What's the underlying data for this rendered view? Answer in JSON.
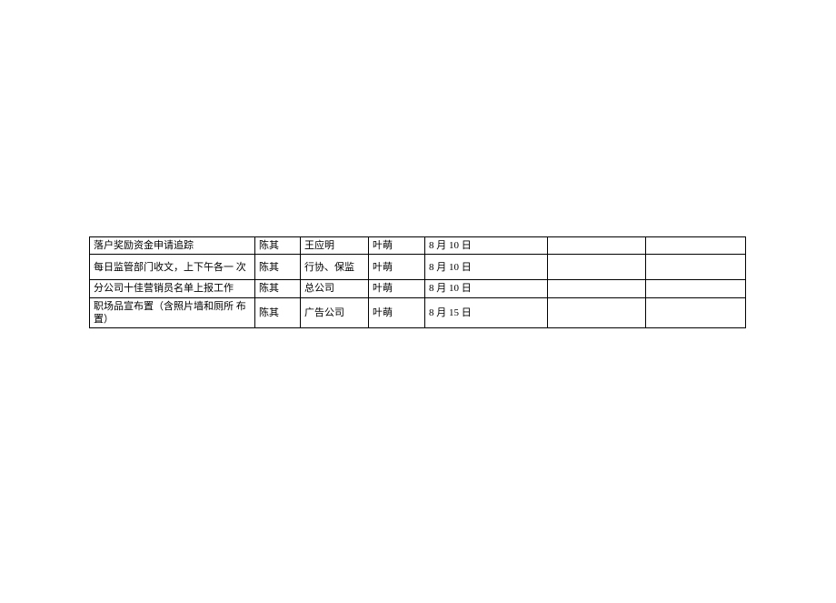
{
  "table": {
    "rows": [
      {
        "task": "落户奖励资金申请追踪",
        "owner": "陈其",
        "dept": "王应明",
        "lead": "叶萌",
        "date": "8 月 10 日",
        "c6": "",
        "c7": ""
      },
      {
        "task": "每日监管部门收文，上下午各一 次",
        "owner": "陈其",
        "dept": "行协、保监",
        "lead": "叶萌",
        "date": "8 月 10 日",
        "c6": "",
        "c7": ""
      },
      {
        "task": "分公司十佳营销员名单上报工作",
        "owner": "陈其",
        "dept": "总公司",
        "lead": "叶萌",
        "date": "8 月 10 日",
        "c6": "",
        "c7": ""
      },
      {
        "task": "职场品宣布置（含照片墙和厕所 布置）",
        "owner": "陈其",
        "dept": "广告公司",
        "lead": "叶萌",
        "date": "8 月  15  日",
        "c6": "",
        "c7": ""
      }
    ]
  }
}
